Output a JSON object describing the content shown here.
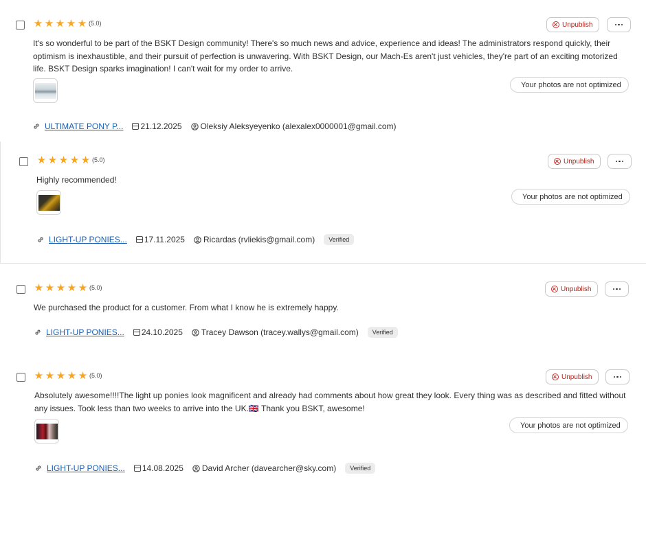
{
  "reviews": [
    {
      "rating_label": "(5.0)",
      "unpublish_label": "Unpublish",
      "text": "It's so wonderful to be part of the BSKT Design community! There's so much news and advice, experience and ideas! The administrators respond quickly, their optimism is inexhaustible, and their pursuit of perfection is unwavering. With BSKT Design, our Mach-Es aren't just vehicles, they're part of an exciting motorized life. BSKT Design sparks imagination! I can't wait for my order to arrive.",
      "photo_badge": "Your photos are not optimized",
      "product": "ULTIMATE PONY P...",
      "date": "21.12.2025",
      "author": "Oleksiy Aleksyeyenko (alexalex0000001@gmail.com)"
    },
    {
      "rating_label": "(5.0)",
      "unpublish_label": "Unpublish",
      "text": "Highly recommended!",
      "photo_badge": "Your photos are not optimized",
      "product": "LIGHT-UP PONIES...",
      "date": "17.11.2025",
      "author": "Ricardas (rvliekis@gmail.com)",
      "verified": "Verified"
    },
    {
      "rating_label": "(5.0)",
      "unpublish_label": "Unpublish",
      "text": "We purchased the product for a customer. From what I know he is extremely happy.",
      "product": "LIGHT-UP PONIES...",
      "date": "24.10.2025",
      "author": "Tracey Dawson (tracey.wallys@gmail.com)",
      "verified": "Verified"
    },
    {
      "rating_label": "(5.0)",
      "unpublish_label": "Unpublish",
      "text": "Absolutely awesome!!!!The light up ponies look magnificent and already had comments about how great they look. Every thing was as described and fitted without any issues. Took less than two weeks to arrive into the UK.🇬🇧 Thank you BSKT, awesome!",
      "photo_badge": "Your photos are not optimized",
      "product": "LIGHT-UP PONIES...",
      "date": "14.08.2025",
      "author": "David Archer (davearcher@sky.com)",
      "verified": "Verified"
    }
  ],
  "rating_value": 5,
  "colors": {
    "star": "#f5a623",
    "unpublish": "#b42318",
    "link": "#1a5fb4"
  },
  "icons": [
    "star-icon",
    "x-circle-icon",
    "more-dots-icon",
    "link-icon",
    "calendar-icon",
    "user-icon"
  ]
}
